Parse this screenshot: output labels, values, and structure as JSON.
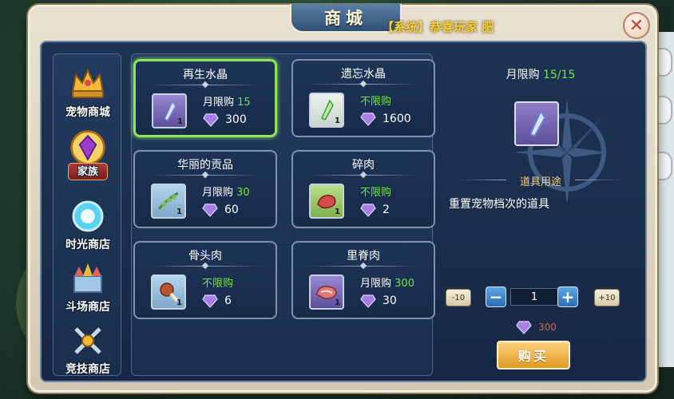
{
  "shop": {
    "title": "商城",
    "system_message": "【系统】恭喜玩家 肥"
  },
  "sidebar": {
    "items": [
      {
        "label": "宠物商城",
        "icon": "pet-shop-crown-icon"
      },
      {
        "label": "家族",
        "icon": "family-crest-icon",
        "active": true
      },
      {
        "label": "时光商店",
        "icon": "time-crystal-icon"
      },
      {
        "label": "斗场商店",
        "icon": "arena-castle-icon"
      },
      {
        "label": "竞技商店",
        "icon": "competition-swords-icon"
      }
    ]
  },
  "items": [
    {
      "name": "再生水晶",
      "limit_label": "月限购",
      "limit_num": "15",
      "unlimited": "",
      "price": "300",
      "count": "1",
      "icon": "purple-crystal-icon",
      "selected": true
    },
    {
      "name": "遗忘水晶",
      "limit_label": "",
      "limit_num": "",
      "unlimited": "不限购",
      "price": "1600",
      "count": "1",
      "icon": "green-crystal-icon"
    },
    {
      "name": "华丽的贡品",
      "limit_label": "月限购",
      "limit_num": "30",
      "unlimited": "",
      "price": "60",
      "count": "1",
      "icon": "herb-offering-icon"
    },
    {
      "name": "碎肉",
      "limit_label": "",
      "limit_num": "",
      "unlimited": "不限购",
      "price": "2",
      "count": "1",
      "icon": "minced-meat-icon"
    },
    {
      "name": "骨头肉",
      "limit_label": "",
      "limit_num": "",
      "unlimited": "不限购",
      "price": "6",
      "count": "1",
      "icon": "bone-meat-icon"
    },
    {
      "name": "里脊肉",
      "limit_label": "月限购",
      "limit_num": "300",
      "unlimited": "",
      "price": "30",
      "count": "1",
      "icon": "tenderloin-icon"
    }
  ],
  "detail": {
    "monthly_label": "月限购",
    "monthly_value": "15/15",
    "use_header": "道具用途",
    "use_text": "重置宠物档次的道具",
    "minus10": "-10",
    "plus10": "+10",
    "minus": "−",
    "plus": "+",
    "quantity": "1",
    "total_price": "300",
    "buy_label": "购买",
    "close_label": "✕"
  },
  "colors": {
    "panel": "#1a2f4d",
    "selected_border": "#8fe35a",
    "limit_green": "#72e34d",
    "buy_button": "#e19b26",
    "total_red": "#e25c4a"
  }
}
